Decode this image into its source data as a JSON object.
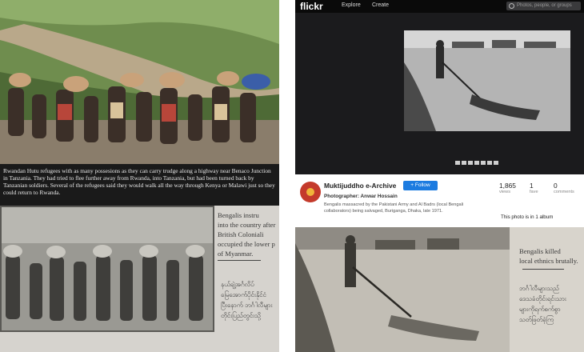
{
  "left_caption": "Rwandan Hutu refugees with as many possesions as they can carry trudge along a highway near Benaco Junction in Tanzania. They had tried to flee further away from Rwanda, into Tanzania, but had been turned back by Tanzanian soldiers. Several of the refugees said they would walk all the way through Kenya or Malawi just so they could return to Rwanda.",
  "left_book": {
    "lines": [
      "Bengalis instru",
      "into the country after",
      "British Coloniali",
      "occupied the lower p",
      "of Myanmar."
    ],
    "burmese": [
      "နယ်ချဲ့အင်္ဂလိပ်",
      "မြေအောက်ပိုင်းနိုင်ငံ",
      "ပြီးနောက် ဘင်္ဂါလီများ",
      "တိုင်းပြည်တွင်းသို့"
    ]
  },
  "flickr": {
    "logo": "flickr",
    "nav": [
      "Explore",
      "Create"
    ],
    "search_placeholder": "Photos, people, or groups",
    "account": "Muktijuddho e-Archive",
    "follow_label": "+ Follow",
    "photographer": "Photographer: Anwar Hossain",
    "description": "Bengalis massacred by the Pakistani Army and Al Badrs (local Bengali collaborators) being salvaged, Buriganga, Dhaka, late 1971.",
    "stats": [
      {
        "value": "1,865",
        "label": "views"
      },
      {
        "value": "1",
        "label": "fave"
      },
      {
        "value": "0",
        "label": "comments"
      }
    ],
    "album_text": "This photo is in 1 album"
  },
  "right_book": {
    "lines": [
      "Bengalis killed",
      "local ethnics brutally."
    ],
    "burmese": [
      "ဘင်္ဂါလီများသည်",
      "ဒေသခံတိုင်းရင်းသား",
      "များကိုရက်စက်စွာ",
      "သတ်ဖြတ်ခဲ့ကြ"
    ]
  }
}
